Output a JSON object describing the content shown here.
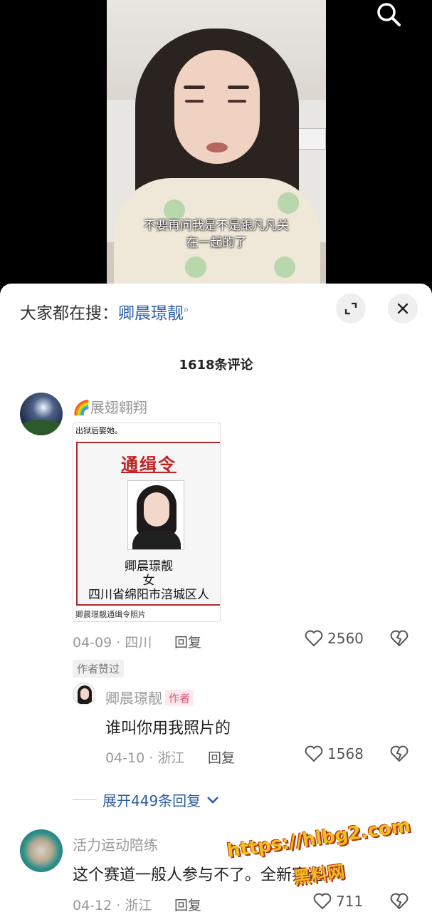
{
  "video": {
    "subtitle_line1": "不要再问我是不是跟凡凡关",
    "subtitle_line2": "在一起的了",
    "search_icon": "search-icon"
  },
  "panel": {
    "search_prefix": "大家都在搜：",
    "search_term": "卿晨璟靓",
    "search_glyph": "⌕",
    "expand_icon": "expand-icon",
    "close_icon": "close-icon",
    "comment_count": "1618条评论"
  },
  "comments": [
    {
      "user": "展翅翱翔",
      "image": {
        "caption": "出狱后娶她。",
        "title": "通缉令",
        "name": "卿晨璟靓",
        "gender": "女",
        "address": "四川省绵阳市涪城区人",
        "footer": "卿晨璟靓通缉令照片"
      },
      "date_loc": "04-09 · 四川",
      "reply_label": "回复",
      "likes": "2560",
      "author_liked": "作者赞过"
    },
    {
      "user": "卿晨璟靓",
      "author_tag": "作者",
      "text": "谁叫你用我照片的",
      "date_loc": "04-10 · 浙江",
      "reply_label": "回复",
      "likes": "1568"
    },
    {
      "user": "活力运动陪练",
      "text": "这个赛道一般人参与不了。全新赛道",
      "date_loc": "04-12 · 浙江",
      "reply_label": "回复",
      "likes": "711"
    }
  ],
  "expand_replies": "展开449条回复",
  "watermark": {
    "url": "https://hlbg2.com",
    "name": "黑料网"
  },
  "colors": {
    "link": "#2c5ea8",
    "author_tag": "#e05475"
  }
}
